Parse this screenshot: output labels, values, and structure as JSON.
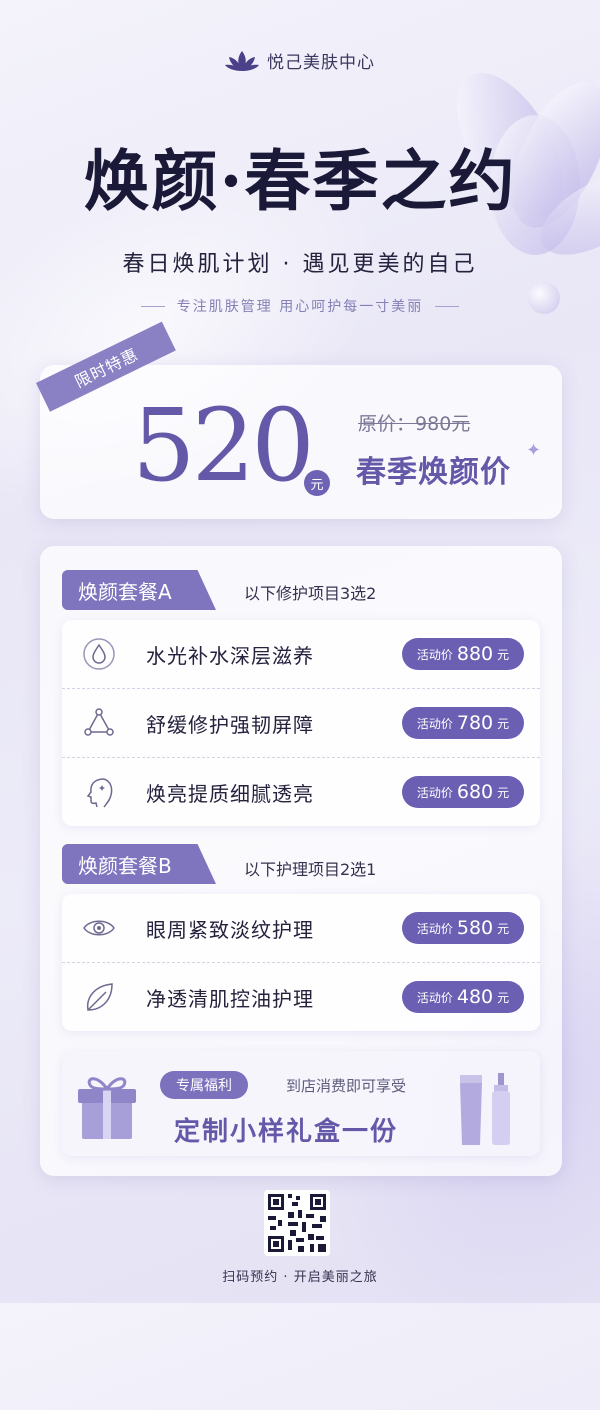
{
  "brand": {
    "name": "悦己美肤中心",
    "icon": "lotus-icon"
  },
  "hero": {
    "title": "焕颜·春季之约",
    "subtitle": "春日焕肌计划 · 遇见更美的自己",
    "tagline": "专注肌肤管理 用心呵护每一寸美丽"
  },
  "offer": {
    "ribbon": "限时特惠",
    "price": "520",
    "unit": "元",
    "original_label": "原价：",
    "original_price": "980元",
    "label": "春季焕颜价"
  },
  "package_a": {
    "tag": "焕颜套餐A",
    "note": "以下修护项目3选2",
    "items": [
      {
        "label": "水光补水深层滋养",
        "price_tag": "活动价",
        "price": "880",
        "unit": "元",
        "icon": "water-drop-icon"
      },
      {
        "label": "舒缓修护强韧屏障",
        "price_tag": "活动价",
        "price": "780",
        "unit": "元",
        "icon": "molecule-icon"
      },
      {
        "label": "焕亮提质细腻透亮",
        "price_tag": "活动价",
        "price": "680",
        "unit": "元",
        "icon": "face-profile-icon"
      }
    ]
  },
  "package_b": {
    "tag": "焕颜套餐B",
    "note": "以下护理项目2选1",
    "items": [
      {
        "label": "眼周紧致淡纹护理",
        "price_tag": "活动价",
        "price": "580",
        "unit": "元",
        "icon": "eye-icon"
      },
      {
        "label": "净透清肌控油护理",
        "price_tag": "活动价",
        "price": "480",
        "unit": "元",
        "icon": "leaf-icon"
      }
    ]
  },
  "gift": {
    "badge": "专属福利",
    "note": "到店消费即可享受",
    "title": "定制小样礼盒一份"
  },
  "footer": {
    "scan_text": "扫码预约 · 开启美丽之旅"
  },
  "colors": {
    "accent": "#6458a8",
    "pill": "#6a5fb2",
    "tag": "#7f75bf"
  }
}
